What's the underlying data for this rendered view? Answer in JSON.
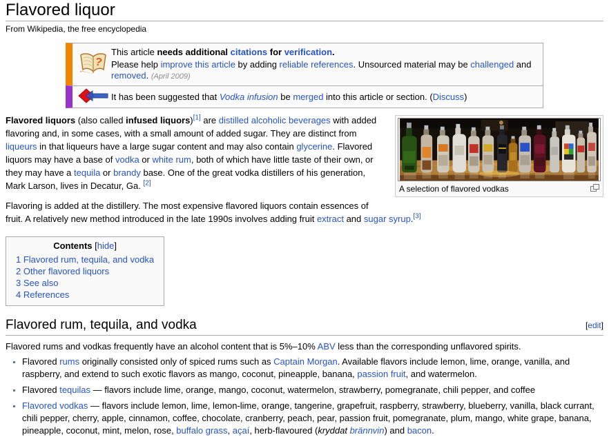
{
  "page": {
    "title": "Flavored liquor",
    "subtitle": "From Wikipedia, the free encyclopedia"
  },
  "theme": {
    "link_color": "#2653c9",
    "citation_box_border": "#f28500",
    "merge_box_border": "#9932cc",
    "box_background": "#fbfbfb"
  },
  "notices": {
    "citations": {
      "line1": [
        {
          "t": "This article "
        },
        {
          "t": "needs additional ",
          "s": "b"
        },
        {
          "t": "citations",
          "s": "bl"
        },
        {
          "t": " for ",
          "s": "b"
        },
        {
          "t": "verification",
          "s": "bl"
        },
        {
          "t": ".",
          "s": "b"
        }
      ],
      "line2": [
        {
          "t": "Please help "
        },
        {
          "t": "improve this article",
          "s": "l"
        },
        {
          "t": " by adding "
        },
        {
          "t": "reliable references",
          "s": "l"
        },
        {
          "t": ". Unsourced material may be "
        },
        {
          "t": "challenged",
          "s": "l"
        },
        {
          "t": " and "
        },
        {
          "t": "removed",
          "s": "l"
        },
        {
          "t": ". "
        },
        {
          "t": "(April 2009)",
          "s": "gi"
        }
      ]
    },
    "merge": {
      "line1": [
        {
          "t": "It has been suggested that "
        },
        {
          "t": "Vodka infusion",
          "s": "li"
        },
        {
          "t": " be "
        },
        {
          "t": "merged",
          "s": "l"
        },
        {
          "t": " into this article or section. ("
        },
        {
          "t": "Discuss",
          "s": "l"
        },
        {
          "t": ")"
        }
      ]
    }
  },
  "article": {
    "paragraph1": [
      {
        "t": "Flavored liquors",
        "s": "b"
      },
      {
        "t": " (also called "
      },
      {
        "t": "infused liquors",
        "s": "b"
      },
      {
        "t": ")"
      },
      {
        "t": "[1]",
        "s": "sup"
      },
      {
        "t": " are "
      },
      {
        "t": "distilled alcoholic beverages",
        "s": "l"
      },
      {
        "t": " with added flavoring and, in some cases, with a small amount of added sugar. They are distinct from "
      },
      {
        "t": "liqueurs",
        "s": "l"
      },
      {
        "t": " in that liqueurs have a large sugar content and may also contain "
      },
      {
        "t": "glycerine",
        "s": "l"
      },
      {
        "t": ". Flavored liquors may have a base of "
      },
      {
        "t": "vodka",
        "s": "l"
      },
      {
        "t": " or "
      },
      {
        "t": "white rum",
        "s": "l"
      },
      {
        "t": ", both of which have little taste of their own, or they may have a "
      },
      {
        "t": "tequila",
        "s": "l"
      },
      {
        "t": " or "
      },
      {
        "t": "brandy",
        "s": "l"
      },
      {
        "t": " base. One of the great vodka distillers of his generation, Mark Larson, lives in Decatur, Ga. "
      },
      {
        "t": "[2]",
        "s": "sup"
      }
    ],
    "paragraph2": [
      {
        "t": "Flavoring is added at the distillery. The most expensive flavored liquors contain essences of fruit. A relatively new method introduced in the late 1990s involves adding fruit "
      },
      {
        "t": "extract",
        "s": "l"
      },
      {
        "t": " and "
      },
      {
        "t": "sugar syrup",
        "s": "l"
      },
      {
        "t": "."
      },
      {
        "t": "[3]",
        "s": "sup"
      }
    ]
  },
  "image": {
    "caption": "A selection of flavored vodkas"
  },
  "contents": {
    "header": "Contents",
    "hide": [
      {
        "t": "["
      },
      {
        "t": "hide",
        "s": "l"
      },
      {
        "t": "]"
      }
    ],
    "items": [
      "1 Flavored rum, tequila, and vodka",
      "2 Other flavored liquors",
      "3 See also",
      "4 References"
    ]
  },
  "section1": {
    "heading": "Flavored rum, tequila, and vodka",
    "edit": [
      {
        "t": "["
      },
      {
        "t": "edit",
        "s": "l"
      },
      {
        "t": "]"
      }
    ],
    "intro": [
      {
        "t": "Flavored rums and vodkas frequently have an alcohol content that is 5%–10% "
      },
      {
        "t": "ABV",
        "s": "l"
      },
      {
        "t": " less than the corresponding unflavored spirits."
      }
    ],
    "bullets": [
      [
        {
          "t": "Flavored "
        },
        {
          "t": "rums",
          "s": "l"
        },
        {
          "t": " originally consisted only of spiced rums such as "
        },
        {
          "t": "Captain Morgan",
          "s": "l"
        },
        {
          "t": ". Available flavors include lemon, lime, orange, vanilla, and raspberry, and extend to such exotic flavors as mango, coconut, pineapple, banana, "
        },
        {
          "t": "passion fruit",
          "s": "l"
        },
        {
          "t": ", and watermelon."
        }
      ],
      [
        {
          "t": "Flavored "
        },
        {
          "t": "tequilas",
          "s": "l"
        },
        {
          "t": " — flavors include lime, orange, mango, coconut, watermelon, strawberry, pomegranate, chili pepper, and coffee"
        }
      ],
      [
        {
          "t": "Flavored vodkas",
          "s": "l"
        },
        {
          "t": " — flavors include lemon, lime, lemon-lime, orange, tangerine, grapefruit, raspberry, strawberry, blueberry, vanilla, black currant, chili pepper, cherry, apple, cinnamon, coffee, chocolate, cranberry, peach, pear, passion fruit, pomegranate, plum, mango, white grape, banana, pineapple, coconut, mint, melon, rose, "
        },
        {
          "t": "buffalo grass",
          "s": "l"
        },
        {
          "t": ", "
        },
        {
          "t": "açaí",
          "s": "l"
        },
        {
          "t": ", herb-flavoured ("
        },
        {
          "t": "kryddat ",
          "s": "i"
        },
        {
          "t": "brännvin",
          "s": "li"
        },
        {
          "t": ") and "
        },
        {
          "t": "bacon",
          "s": "l"
        },
        {
          "t": "."
        }
      ]
    ]
  }
}
